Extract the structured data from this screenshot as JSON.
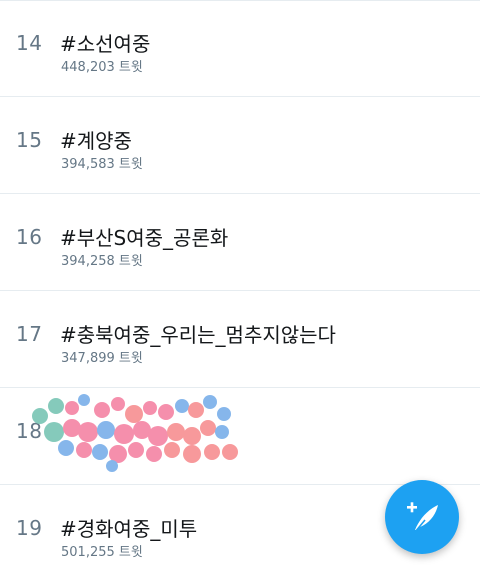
{
  "trends": [
    {
      "rank": "14",
      "hashtag": "#소선여중",
      "tweets": "448,203 트윗"
    },
    {
      "rank": "15",
      "hashtag": "#계양중",
      "tweets": "394,583 트윗"
    },
    {
      "rank": "16",
      "hashtag": "#부산S여중_공론화",
      "tweets": "394,258 트윗"
    },
    {
      "rank": "17",
      "hashtag": "#충북여중_우리는_멈추지않는다",
      "tweets": "347,899 트윗"
    },
    {
      "rank": "18",
      "hashtag": "",
      "tweets": ""
    },
    {
      "rank": "19",
      "hashtag": "#경화여중_미투",
      "tweets": "501,255 트윗"
    }
  ],
  "colors": {
    "accent": "#1da1f2",
    "text_primary": "#14171a",
    "text_secondary": "#657786",
    "divider": "#e6ecf0"
  },
  "fab": {
    "icon": "compose-tweet-icon"
  }
}
